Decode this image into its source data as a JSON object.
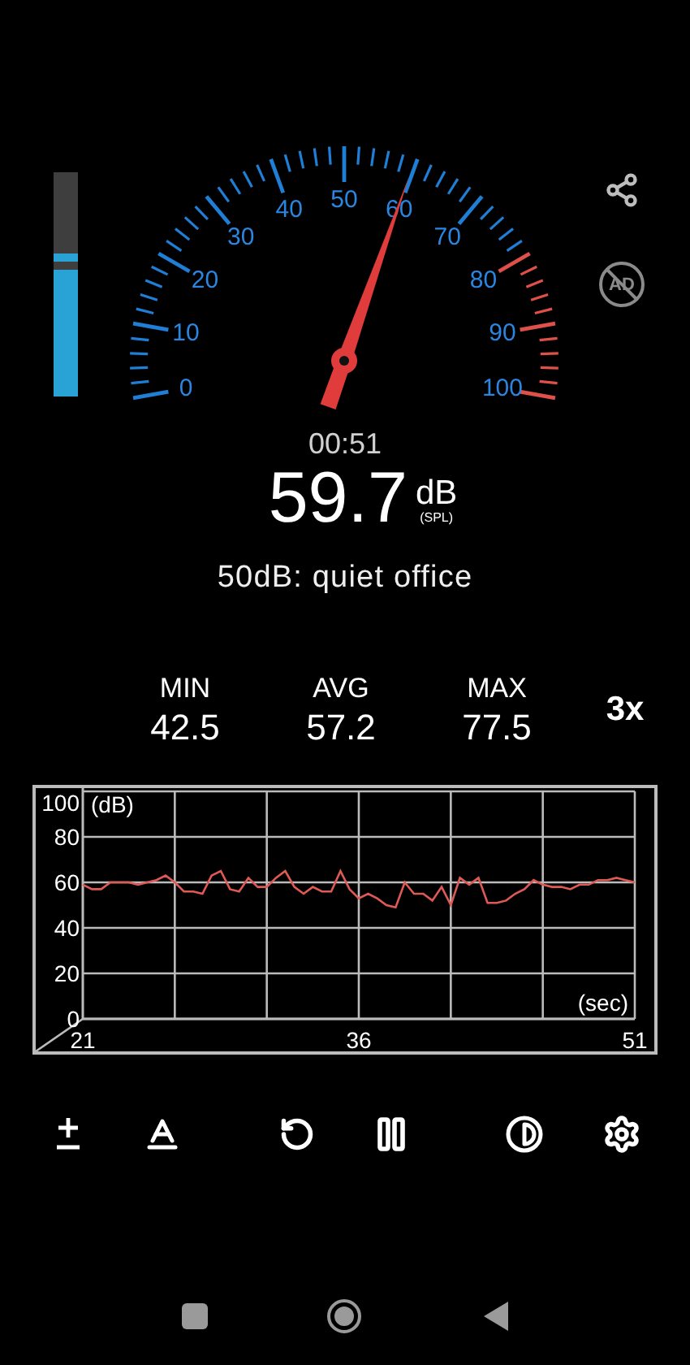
{
  "meter": {
    "level": 0.64
  },
  "top_actions": [
    {
      "kind": "share"
    },
    {
      "kind": "no_ads",
      "label": "AD"
    }
  ],
  "gauge": {
    "scale_labels": [
      "0",
      "10",
      "20",
      "30",
      "40",
      "50",
      "60",
      "70",
      "80",
      "90",
      "100"
    ]
  },
  "timer": "00:51",
  "reading": {
    "value": "59.7",
    "unit": "dB",
    "weighting": "(SPL)"
  },
  "description": "50dB: quiet office",
  "stats": [
    {
      "label": "MIN",
      "value": "42.5"
    },
    {
      "label": "AVG",
      "value": "57.2"
    },
    {
      "label": "MAX",
      "value": "77.5"
    }
  ],
  "speed": "3x",
  "chart": {
    "chart_data": {
      "type": "line",
      "xlabel": "(sec)",
      "ylabel": "(dB)",
      "xlim": [
        21,
        51
      ],
      "ylim": [
        0,
        100
      ],
      "xticks": [
        21,
        36,
        51
      ],
      "yticks": [
        0,
        20,
        40,
        60,
        80,
        100
      ],
      "grid": true,
      "x": [
        21,
        21.5,
        22,
        22.5,
        23,
        23.5,
        24,
        24.5,
        25,
        25.5,
        26,
        26.5,
        27,
        27.5,
        28,
        28.5,
        29,
        29.5,
        30,
        30.5,
        31,
        31.5,
        32,
        32.5,
        33,
        33.5,
        34,
        34.5,
        35,
        35.5,
        36,
        36.5,
        37,
        37.5,
        38,
        38.5,
        39,
        39.5,
        40,
        40.5,
        41,
        41.5,
        42,
        42.5,
        43,
        43.5,
        44,
        44.5,
        45,
        45.5,
        46,
        46.5,
        47,
        47.5,
        48,
        48.5,
        49,
        49.5,
        50,
        50.5,
        51
      ],
      "series": [
        {
          "color": "#e05a55",
          "values": [
            59,
            57,
            57,
            60,
            60,
            60,
            59,
            60,
            61,
            63,
            60,
            56,
            56,
            55,
            63,
            65,
            57,
            56,
            62,
            58,
            58,
            62,
            65,
            58,
            55,
            58,
            56,
            56,
            65,
            57,
            53,
            55,
            53,
            50,
            49,
            60,
            55,
            55,
            52,
            58,
            50,
            62,
            59,
            62,
            51,
            51,
            52,
            55,
            57,
            61,
            59,
            58,
            58,
            57,
            59,
            59,
            61,
            61,
            62,
            61,
            60
          ]
        }
      ]
    }
  },
  "toolbar": [
    {
      "kind": "plus_minus"
    },
    {
      "kind": "text_underline"
    },
    {
      "kind": "reset"
    },
    {
      "kind": "pause"
    },
    {
      "kind": "contrast"
    },
    {
      "kind": "settings"
    }
  ],
  "nav_bar": [
    {
      "kind": "recents"
    },
    {
      "kind": "home"
    },
    {
      "kind": "back"
    }
  ]
}
